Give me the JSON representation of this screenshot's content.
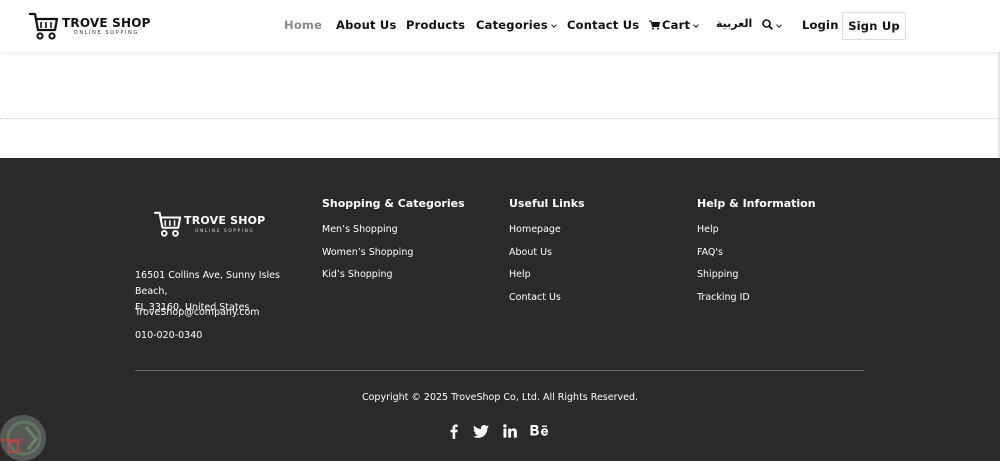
{
  "header": {
    "logo": {
      "name": "TROVE SHOP",
      "tagline": "ONLINE SOPPING"
    },
    "nav": {
      "home": "Home",
      "about": "About Us",
      "products": "Products",
      "categories": "Categories",
      "contact": "Contact Us",
      "cart": "Cart",
      "arabic": "العربية",
      "login": "Login",
      "signup": "Sign Up"
    }
  },
  "footer": {
    "logo": {
      "name": "TROVE SHOP",
      "tagline": "ONLINE SOPPING"
    },
    "address_line1": "16501 Collins Ave, Sunny Isles Beach,",
    "address_line2": "FL 33160, United States",
    "email": "TroveShop@company.com",
    "phone": "010-020-0340",
    "columns": [
      {
        "title": "Shopping & Categories",
        "links": [
          "Men’s Shopping",
          "Women’s Shopping",
          "Kid’s Shopping"
        ]
      },
      {
        "title": "Useful Links",
        "links": [
          "Homepage",
          "About Us",
          "Help",
          "Contact Us"
        ]
      },
      {
        "title": "Help & Information",
        "links": [
          "Help",
          "FAQ's",
          "Shipping",
          "Tracking ID"
        ]
      }
    ],
    "copyright": "Copyright © 2025 TroveShop Co, Ltd. All Rights Reserved.",
    "social": [
      "facebook-icon",
      "twitter-icon",
      "linkedin-icon",
      "behance-icon"
    ]
  },
  "colors": {
    "footer_bg": "#2a2a2a",
    "active_nav": "#8a8a8a"
  }
}
